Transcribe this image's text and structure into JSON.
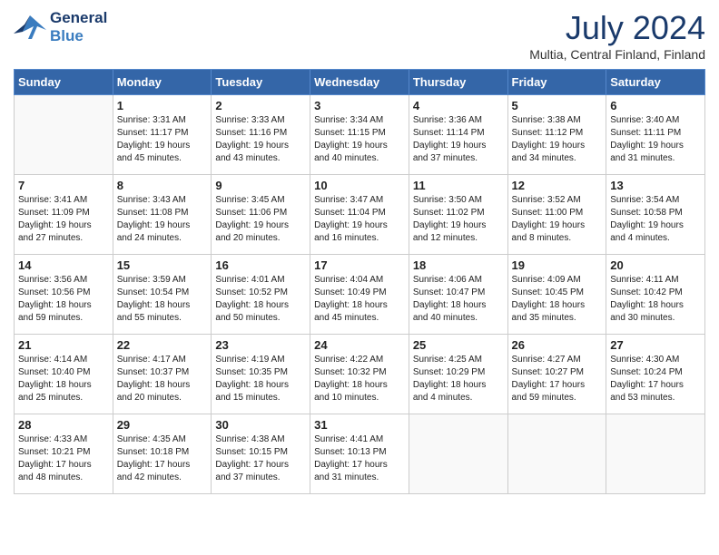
{
  "header": {
    "logo_line1": "General",
    "logo_line2": "Blue",
    "month_year": "July 2024",
    "location": "Multia, Central Finland, Finland"
  },
  "weekdays": [
    "Sunday",
    "Monday",
    "Tuesday",
    "Wednesday",
    "Thursday",
    "Friday",
    "Saturday"
  ],
  "weeks": [
    [
      {
        "day": "",
        "info": ""
      },
      {
        "day": "1",
        "info": "Sunrise: 3:31 AM\nSunset: 11:17 PM\nDaylight: 19 hours\nand 45 minutes."
      },
      {
        "day": "2",
        "info": "Sunrise: 3:33 AM\nSunset: 11:16 PM\nDaylight: 19 hours\nand 43 minutes."
      },
      {
        "day": "3",
        "info": "Sunrise: 3:34 AM\nSunset: 11:15 PM\nDaylight: 19 hours\nand 40 minutes."
      },
      {
        "day": "4",
        "info": "Sunrise: 3:36 AM\nSunset: 11:14 PM\nDaylight: 19 hours\nand 37 minutes."
      },
      {
        "day": "5",
        "info": "Sunrise: 3:38 AM\nSunset: 11:12 PM\nDaylight: 19 hours\nand 34 minutes."
      },
      {
        "day": "6",
        "info": "Sunrise: 3:40 AM\nSunset: 11:11 PM\nDaylight: 19 hours\nand 31 minutes."
      }
    ],
    [
      {
        "day": "7",
        "info": "Sunrise: 3:41 AM\nSunset: 11:09 PM\nDaylight: 19 hours\nand 27 minutes."
      },
      {
        "day": "8",
        "info": "Sunrise: 3:43 AM\nSunset: 11:08 PM\nDaylight: 19 hours\nand 24 minutes."
      },
      {
        "day": "9",
        "info": "Sunrise: 3:45 AM\nSunset: 11:06 PM\nDaylight: 19 hours\nand 20 minutes."
      },
      {
        "day": "10",
        "info": "Sunrise: 3:47 AM\nSunset: 11:04 PM\nDaylight: 19 hours\nand 16 minutes."
      },
      {
        "day": "11",
        "info": "Sunrise: 3:50 AM\nSunset: 11:02 PM\nDaylight: 19 hours\nand 12 minutes."
      },
      {
        "day": "12",
        "info": "Sunrise: 3:52 AM\nSunset: 11:00 PM\nDaylight: 19 hours\nand 8 minutes."
      },
      {
        "day": "13",
        "info": "Sunrise: 3:54 AM\nSunset: 10:58 PM\nDaylight: 19 hours\nand 4 minutes."
      }
    ],
    [
      {
        "day": "14",
        "info": "Sunrise: 3:56 AM\nSunset: 10:56 PM\nDaylight: 18 hours\nand 59 minutes."
      },
      {
        "day": "15",
        "info": "Sunrise: 3:59 AM\nSunset: 10:54 PM\nDaylight: 18 hours\nand 55 minutes."
      },
      {
        "day": "16",
        "info": "Sunrise: 4:01 AM\nSunset: 10:52 PM\nDaylight: 18 hours\nand 50 minutes."
      },
      {
        "day": "17",
        "info": "Sunrise: 4:04 AM\nSunset: 10:49 PM\nDaylight: 18 hours\nand 45 minutes."
      },
      {
        "day": "18",
        "info": "Sunrise: 4:06 AM\nSunset: 10:47 PM\nDaylight: 18 hours\nand 40 minutes."
      },
      {
        "day": "19",
        "info": "Sunrise: 4:09 AM\nSunset: 10:45 PM\nDaylight: 18 hours\nand 35 minutes."
      },
      {
        "day": "20",
        "info": "Sunrise: 4:11 AM\nSunset: 10:42 PM\nDaylight: 18 hours\nand 30 minutes."
      }
    ],
    [
      {
        "day": "21",
        "info": "Sunrise: 4:14 AM\nSunset: 10:40 PM\nDaylight: 18 hours\nand 25 minutes."
      },
      {
        "day": "22",
        "info": "Sunrise: 4:17 AM\nSunset: 10:37 PM\nDaylight: 18 hours\nand 20 minutes."
      },
      {
        "day": "23",
        "info": "Sunrise: 4:19 AM\nSunset: 10:35 PM\nDaylight: 18 hours\nand 15 minutes."
      },
      {
        "day": "24",
        "info": "Sunrise: 4:22 AM\nSunset: 10:32 PM\nDaylight: 18 hours\nand 10 minutes."
      },
      {
        "day": "25",
        "info": "Sunrise: 4:25 AM\nSunset: 10:29 PM\nDaylight: 18 hours\nand 4 minutes."
      },
      {
        "day": "26",
        "info": "Sunrise: 4:27 AM\nSunset: 10:27 PM\nDaylight: 17 hours\nand 59 minutes."
      },
      {
        "day": "27",
        "info": "Sunrise: 4:30 AM\nSunset: 10:24 PM\nDaylight: 17 hours\nand 53 minutes."
      }
    ],
    [
      {
        "day": "28",
        "info": "Sunrise: 4:33 AM\nSunset: 10:21 PM\nDaylight: 17 hours\nand 48 minutes."
      },
      {
        "day": "29",
        "info": "Sunrise: 4:35 AM\nSunset: 10:18 PM\nDaylight: 17 hours\nand 42 minutes."
      },
      {
        "day": "30",
        "info": "Sunrise: 4:38 AM\nSunset: 10:15 PM\nDaylight: 17 hours\nand 37 minutes."
      },
      {
        "day": "31",
        "info": "Sunrise: 4:41 AM\nSunset: 10:13 PM\nDaylight: 17 hours\nand 31 minutes."
      },
      {
        "day": "",
        "info": ""
      },
      {
        "day": "",
        "info": ""
      },
      {
        "day": "",
        "info": ""
      }
    ]
  ]
}
